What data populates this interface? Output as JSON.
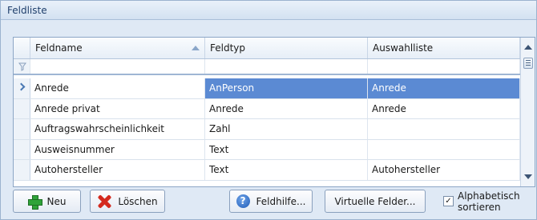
{
  "panel": {
    "title": "Feldliste"
  },
  "grid": {
    "columns": [
      "Feldname",
      "Feldtyp",
      "Auswahlliste"
    ],
    "rows": [
      {
        "feldname": "Anrede",
        "feldtyp": "AnPerson",
        "auswahlliste": "Anrede",
        "selected": true
      },
      {
        "feldname": "Anrede privat",
        "feldtyp": "Anrede",
        "auswahlliste": "Anrede"
      },
      {
        "feldname": "Auftragswahrscheinlichkeit",
        "feldtyp": "Zahl",
        "auswahlliste": ""
      },
      {
        "feldname": "Ausweisnummer",
        "feldtyp": "Text",
        "auswahlliste": ""
      },
      {
        "feldname": "Autohersteller",
        "feldtyp": "Text",
        "auswahlliste": "Autohersteller"
      }
    ]
  },
  "buttons": {
    "new": "Neu",
    "delete": "Löschen",
    "help": "Feldhilfe...",
    "virtual": "Virtuelle Felder..."
  },
  "checkbox": {
    "line1": "Alphabetisch",
    "line2": "sortieren",
    "checked": true,
    "mark": "✓"
  },
  "icons": {
    "filter": "funnel-icon",
    "row_pointer": "chevron-right-icon",
    "sort": "sort-ascending-icon",
    "new": "plus-icon",
    "delete": "delete-x-icon",
    "help": "help-icon"
  },
  "colors": {
    "selection": "#5b8ad3",
    "panel_bg": "#dfe9f5",
    "header_text": "#1e3e6b"
  }
}
